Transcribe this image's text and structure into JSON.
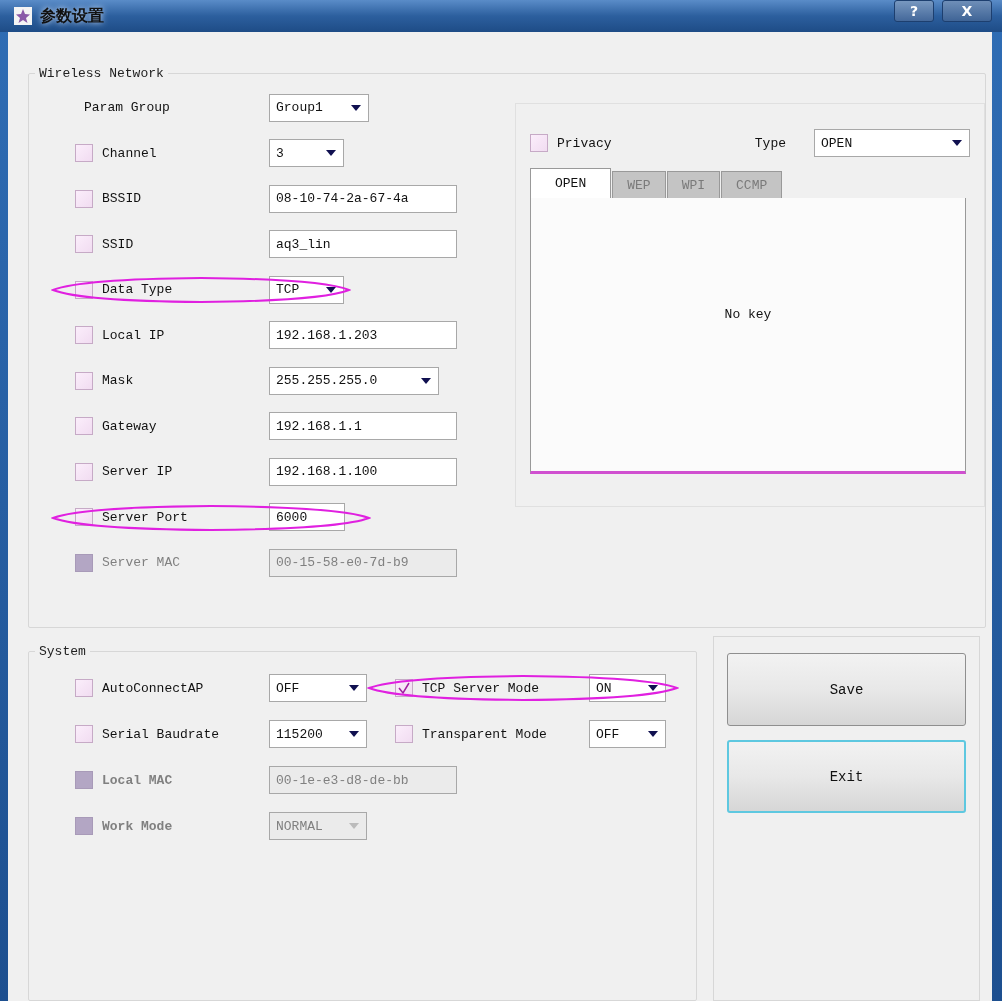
{
  "window": {
    "title": "参数设置",
    "buttons": [
      {
        "kind": "help",
        "label": "?"
      },
      {
        "kind": "close",
        "label": "X"
      }
    ]
  },
  "wireless": {
    "title": "Wireless Network",
    "rows": [
      {
        "kind": "select",
        "label": "Param Group",
        "checkable": false,
        "disabled": false,
        "highlighted": false,
        "value": "Group1"
      },
      {
        "kind": "select",
        "label": "Channel",
        "checkable": true,
        "checked": false,
        "disabled": false,
        "highlighted": false,
        "value": "3"
      },
      {
        "kind": "text",
        "label": "BSSID",
        "checkable": true,
        "checked": false,
        "disabled": false,
        "highlighted": false,
        "value": "08-10-74-2a-67-4a"
      },
      {
        "kind": "text",
        "label": "SSID",
        "checkable": true,
        "checked": false,
        "disabled": false,
        "highlighted": false,
        "value": "aq3_lin"
      },
      {
        "kind": "select",
        "label": "Data Type",
        "checkable": true,
        "checked": false,
        "disabled": false,
        "highlighted": true,
        "value": "TCP"
      },
      {
        "kind": "text",
        "label": "Local IP",
        "checkable": true,
        "checked": false,
        "disabled": false,
        "highlighted": false,
        "value": "192.168.1.203"
      },
      {
        "kind": "select",
        "label": "Mask",
        "checkable": true,
        "checked": false,
        "disabled": false,
        "highlighted": false,
        "value": "255.255.255.0"
      },
      {
        "kind": "text",
        "label": "Gateway",
        "checkable": true,
        "checked": false,
        "disabled": false,
        "highlighted": false,
        "value": "192.168.1.1"
      },
      {
        "kind": "text",
        "label": "Server IP",
        "checkable": true,
        "checked": false,
        "disabled": false,
        "highlighted": false,
        "value": "192.168.1.100"
      },
      {
        "kind": "number",
        "label": "Server Port",
        "checkable": true,
        "checked": false,
        "disabled": false,
        "highlighted": true,
        "value": "6000"
      },
      {
        "kind": "text",
        "label": "Server MAC",
        "checkable": true,
        "checked": false,
        "disabled": true,
        "highlighted": false,
        "value": "00-15-58-e0-7d-b9"
      }
    ],
    "privacy": {
      "label": "Privacy",
      "checked": false,
      "type_label": "Type",
      "type_value": "OPEN",
      "tabs": [
        {
          "label": "OPEN",
          "selected": true
        },
        {
          "label": "WEP",
          "selected": false
        },
        {
          "label": "WPI",
          "selected": false
        },
        {
          "label": "CCMP",
          "selected": false
        }
      ],
      "message": "No key"
    }
  },
  "system": {
    "title": "System",
    "lines": [
      {
        "items": [
          {
            "kind": "select",
            "label": "AutoConnectAP",
            "checked": false,
            "disabled": false,
            "bold": false,
            "highlighted": false,
            "value": "OFF"
          },
          {
            "kind": "select",
            "label": "TCP Server Mode",
            "checked": true,
            "disabled": false,
            "bold": false,
            "highlighted": true,
            "value": "ON"
          }
        ]
      },
      {
        "items": [
          {
            "kind": "select",
            "label": "Serial Baudrate",
            "checked": false,
            "disabled": false,
            "bold": false,
            "highlighted": false,
            "value": "115200"
          },
          {
            "kind": "select",
            "label": "Transparent Mode",
            "checked": false,
            "disabled": false,
            "bold": false,
            "highlighted": false,
            "value": "OFF"
          }
        ]
      },
      {
        "items": [
          {
            "kind": "text",
            "label": "Local MAC",
            "checked": false,
            "disabled": true,
            "bold": true,
            "highlighted": false,
            "value": "00-1e-e3-d8-de-bb"
          }
        ]
      },
      {
        "items": [
          {
            "kind": "select",
            "label": "Work Mode",
            "checked": false,
            "disabled": true,
            "bold": true,
            "highlighted": false,
            "value": "NORMAL"
          }
        ]
      }
    ]
  },
  "actions": [
    {
      "label": "Save",
      "focused": false
    },
    {
      "label": "Exit",
      "focused": true
    }
  ]
}
